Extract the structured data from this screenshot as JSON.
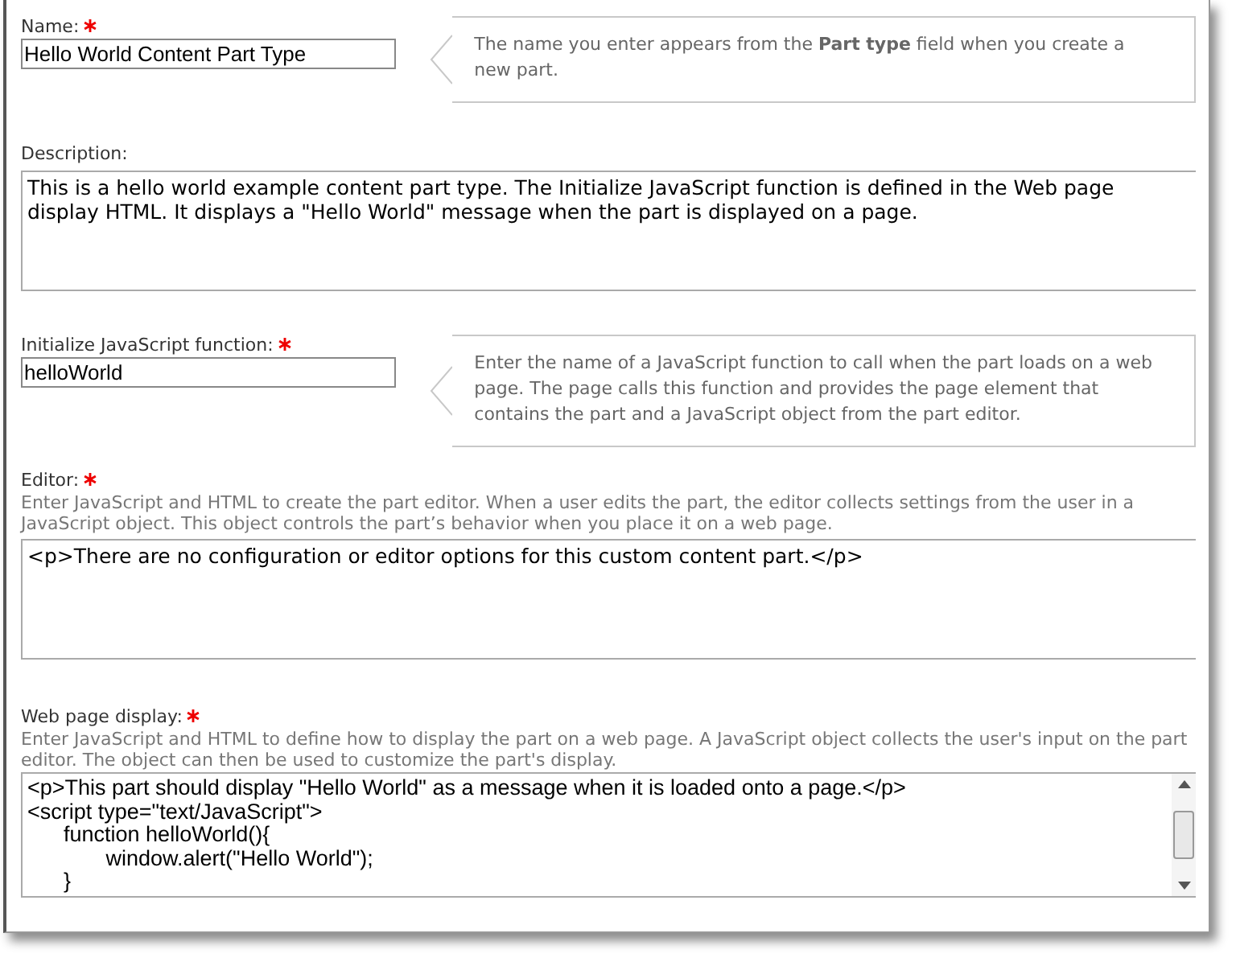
{
  "fields": [
    {
      "kind": "input",
      "label": "Name:",
      "required": true,
      "value": "Hello World Content Part Type",
      "hint": "The name you enter appears from the **Part type** field when you create a new part."
    },
    {
      "kind": "textarea",
      "label": "Description:",
      "required": false,
      "value": "This is a hello world example content part type. The Initialize JavaScript function is defined in the Web page display HTML. It displays a \"Hello World\" message when the part is displayed on a page."
    },
    {
      "kind": "input",
      "label": "Initialize JavaScript function:",
      "required": true,
      "value": "helloWorld",
      "hint": "Enter the name of a JavaScript function to call when the part loads on a web page. The page calls this function and provides the page element that contains the part and a JavaScript object from the part editor."
    },
    {
      "kind": "textarea",
      "label": "Editor:",
      "required": true,
      "help": "Enter JavaScript and HTML to create the part editor. When a user edits the part, the editor collects settings from the user in a JavaScript object. This object controls the part’s behavior when you place it on a web page.",
      "value": "<p>There are no configuration or editor options for this custom content part.</p>"
    },
    {
      "kind": "code",
      "label": "Web page display:",
      "required": true,
      "help": "Enter JavaScript and HTML to define how to display the part on a web page. A JavaScript object collects the user's input on the part editor. The object can then be used to customize the part's display.",
      "value": "<p>This part should display \"Hello World\" as a message when it is loaded onto a page.</p>\n<script type=\"text/JavaScript\">\n      function helloWorld(){\n             window.alert(\"Hello World\");\n      }"
    }
  ]
}
